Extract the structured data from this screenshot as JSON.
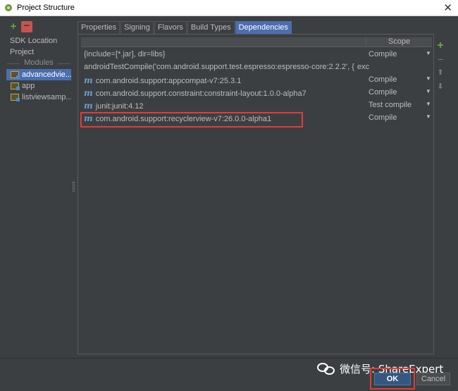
{
  "window": {
    "title": "Project Structure",
    "close_glyph": "✕"
  },
  "left": {
    "add_glyph": "+",
    "remove_glyph": "−",
    "sdk_location": "SDK Location",
    "project": "Project",
    "modules_header": "Modules",
    "modules": [
      {
        "label": "advancedvie...",
        "selected": true
      },
      {
        "label": "app",
        "selected": false
      },
      {
        "label": "listviewsamp...",
        "selected": false
      }
    ]
  },
  "tabs": [
    {
      "label": "Properties",
      "active": false
    },
    {
      "label": "Signing",
      "active": false
    },
    {
      "label": "Flavors",
      "active": false
    },
    {
      "label": "Build Types",
      "active": false
    },
    {
      "label": "Dependencies",
      "active": true
    }
  ],
  "table": {
    "scope_header": "Scope",
    "rows": [
      {
        "dependency": "{include=[*.jar], dir=libs}",
        "maven": false,
        "scope": "Compile",
        "caret": "▼"
      },
      {
        "dependency": "androidTestCompile('com.android.support.test.espresso:espresso-core:2.2.2', {",
        "maven": false,
        "scope": "exc",
        "caret": ""
      },
      {
        "dependency": "com.android.support:appcompat-v7:25.3.1",
        "maven": true,
        "scope": "Compile",
        "caret": "▼"
      },
      {
        "dependency": "com.android.support.constraint:constraint-layout:1.0.0-alpha7",
        "maven": true,
        "scope": "Compile",
        "caret": "▼"
      },
      {
        "dependency": "junit:junit:4.12",
        "maven": true,
        "scope": "Test compile",
        "caret": "▼"
      },
      {
        "dependency": "com.android.support:recyclerview-v7:26.0.0-alpha1",
        "maven": true,
        "scope": "Compile",
        "caret": "▼",
        "highlighted": true
      }
    ]
  },
  "right_tools": {
    "add": "+",
    "remove": "−",
    "up": "⬆",
    "down": "⬇"
  },
  "buttons": {
    "ok": "OK",
    "cancel": "Cancel"
  },
  "watermark": {
    "text": "微信号: ShareExpert"
  },
  "colors": {
    "accent": "#4b6eaf",
    "highlight": "#e03c3c",
    "add": "#5faa3c"
  }
}
